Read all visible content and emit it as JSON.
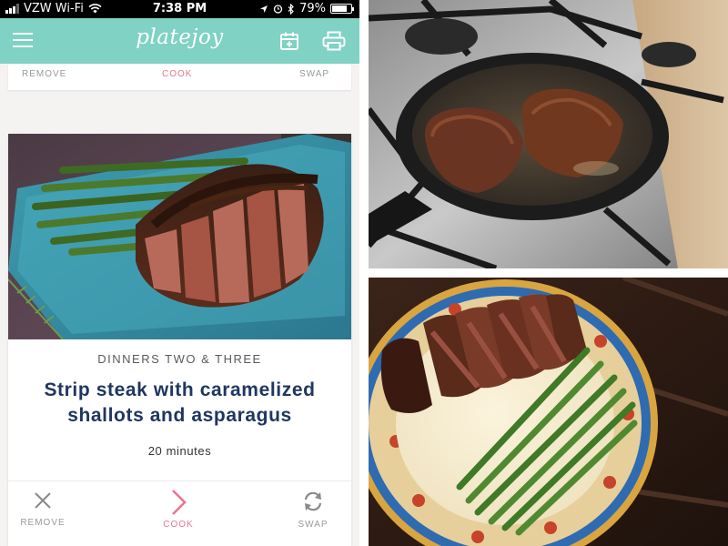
{
  "status_bar": {
    "carrier": "VZW Wi-Fi",
    "time": "7:38 PM",
    "battery_percent": "79%",
    "battery_level": 0.79
  },
  "app": {
    "logo": "platejoy"
  },
  "previous_card": {
    "remove_label": "REMOVE",
    "cook_label": "COOK",
    "swap_label": "SWAP"
  },
  "recipe_card": {
    "category": "DINNERS TWO & THREE",
    "title_line1": "Strip steak with caramelized",
    "title_line2": "shallots and asparagus",
    "time": "20 minutes",
    "actions": {
      "remove_label": "REMOVE",
      "cook_label": "COOK",
      "swap_label": "SWAP"
    }
  },
  "colors": {
    "brand_teal": "#7fd2c4",
    "cook_pink": "#e8768c",
    "title_navy": "#1f3760"
  },
  "icons": [
    "wifi-icon",
    "menu-icon",
    "calendar-add-icon",
    "printer-icon",
    "close-icon",
    "chevron-right-icon",
    "refresh-icon"
  ]
}
